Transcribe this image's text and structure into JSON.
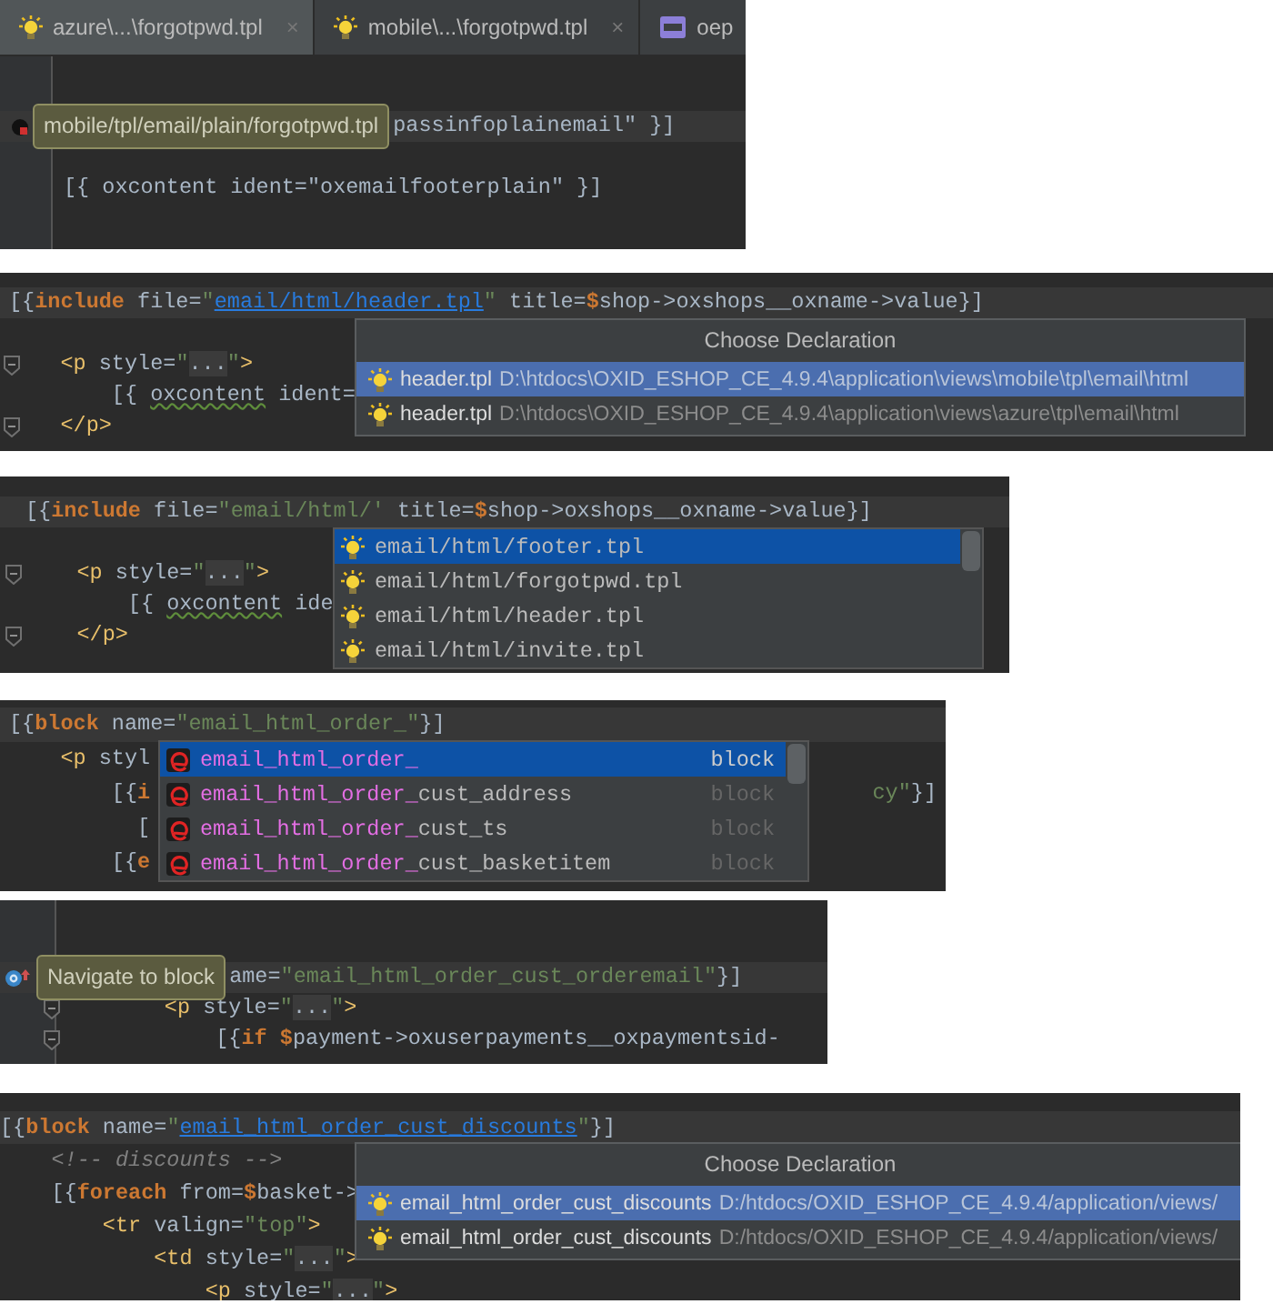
{
  "panels": [
    {
      "tabs": [
        {
          "kind": "tpl",
          "label": "azure\\...\\forgotpwd.tpl",
          "close": "×",
          "selected": true
        },
        {
          "kind": "tpl",
          "label": "mobile\\...\\forgotpwd.tpl",
          "close": "×",
          "selected": false
        },
        {
          "kind": "php",
          "label": "oep",
          "selected": false
        }
      ],
      "lines": [
        {
          "kind": "marker",
          "current": true,
          "tooltip": "mobile/tpl/email/plain/forgotpwd.tpl",
          "tokens": [
            {
              "kind": "plain",
              "text": "passinfoplainemail\" }]"
            }
          ]
        },
        {
          "kind": "code",
          "current": false
        },
        {
          "kind": "code",
          "current": false,
          "tokens": [
            {
              "kind": "plain",
              "text": "[{ oxcontent ident=\"oxemailfooterplain\" }]"
            }
          ]
        }
      ]
    },
    {
      "lines": [
        {
          "kind": "code",
          "current": true,
          "tokens": [
            {
              "kind": "plain",
              "text": "[{"
            },
            {
              "kind": "kw",
              "text": "include"
            },
            {
              "kind": "plain",
              "text": " file="
            },
            {
              "kind": "str",
              "text": "\""
            },
            {
              "kind": "link",
              "text": "email/html/header.tpl"
            },
            {
              "kind": "str",
              "text": "\""
            },
            {
              "kind": "plain",
              "text": " title="
            },
            {
              "kind": "dollar",
              "text": "$"
            },
            {
              "kind": "plain",
              "text": "shop->oxshops__oxname->value}]"
            }
          ]
        },
        {
          "kind": "code",
          "current": false
        },
        {
          "kind": "fold",
          "current": false,
          "tokens": [
            {
              "kind": "tag",
              "text": "    <p"
            },
            {
              "kind": "plain",
              "text": " style="
            },
            {
              "kind": "str",
              "text": "\""
            },
            {
              "kind": "fold",
              "text": "..."
            },
            {
              "kind": "str",
              "text": "\""
            },
            {
              "kind": "tag",
              "text": ">"
            }
          ]
        },
        {
          "kind": "code",
          "current": false,
          "tokens": [
            {
              "kind": "plain",
              "text": "        [{ "
            },
            {
              "kind": "warn",
              "text": "oxcontent"
            },
            {
              "kind": "plain",
              "text": " ident="
            }
          ]
        },
        {
          "kind": "fold",
          "current": false,
          "tokens": [
            {
              "kind": "tag",
              "text": "    </p>"
            }
          ]
        }
      ],
      "popup": {
        "kind": "declaration",
        "title": "Choose Declaration",
        "items": [
          {
            "name": "header.tpl",
            "path": "D:\\htdocs\\OXID_ESHOP_CE_4.9.4\\application\\views\\mobile\\tpl\\email\\html",
            "selected": true
          },
          {
            "name": "header.tpl",
            "path": "D:\\htdocs\\OXID_ESHOP_CE_4.9.4\\application\\views\\azure\\tpl\\email\\html",
            "selected": false
          }
        ]
      }
    },
    {
      "lines": [
        {
          "kind": "code",
          "current": true,
          "tokens": [
            {
              "kind": "plain",
              "text": "[{"
            },
            {
              "kind": "kw",
              "text": "include"
            },
            {
              "kind": "plain",
              "text": " file="
            },
            {
              "kind": "str",
              "text": "\"email/html/"
            },
            {
              "kind": "str",
              "text": "'"
            },
            {
              "kind": "plain",
              "text": " title="
            },
            {
              "kind": "dollar",
              "text": "$"
            },
            {
              "kind": "plain",
              "text": "shop->oxshops__oxname->value}]"
            }
          ]
        },
        {
          "kind": "code",
          "current": false
        },
        {
          "kind": "fold",
          "current": false,
          "tokens": [
            {
              "kind": "tag",
              "text": "    <p"
            },
            {
              "kind": "plain",
              "text": " style="
            },
            {
              "kind": "str",
              "text": "\""
            },
            {
              "kind": "fold",
              "text": "..."
            },
            {
              "kind": "str",
              "text": "\""
            },
            {
              "kind": "tag",
              "text": ">"
            }
          ]
        },
        {
          "kind": "code",
          "current": false,
          "tokens": [
            {
              "kind": "plain",
              "text": "        [{ "
            },
            {
              "kind": "warn",
              "text": "oxcontent"
            },
            {
              "kind": "plain",
              "text": " ide"
            }
          ]
        },
        {
          "kind": "fold",
          "current": false,
          "tokens": [
            {
              "kind": "tag",
              "text": "    </p>"
            }
          ]
        }
      ],
      "popup": {
        "kind": "completion",
        "items": [
          {
            "kind": "file",
            "text": "email/html/footer.tpl",
            "selected": true
          },
          {
            "kind": "file",
            "text": "email/html/forgotpwd.tpl",
            "selected": false
          },
          {
            "kind": "file",
            "text": "email/html/header.tpl",
            "selected": false
          },
          {
            "kind": "file",
            "text": "email/html/invite.tpl",
            "selected": false
          }
        ]
      }
    },
    {
      "lines": [
        {
          "kind": "code",
          "current": true,
          "tokens": [
            {
              "kind": "plain",
              "text": "[{"
            },
            {
              "kind": "kw",
              "text": "block"
            },
            {
              "kind": "plain",
              "text": " name="
            },
            {
              "kind": "str",
              "text": "\"email_html_order_\""
            },
            {
              "kind": "plain",
              "text": "}]"
            }
          ]
        },
        {
          "kind": "code",
          "current": false,
          "tokens": [
            {
              "kind": "tag",
              "text": "    <p"
            },
            {
              "kind": "plain",
              "text": " styl"
            }
          ]
        },
        {
          "kind": "code",
          "current": false,
          "tokens": [
            {
              "kind": "plain",
              "text": "        [{"
            },
            {
              "kind": "kw",
              "text": "i"
            }
          ],
          "tail": [
            {
              "kind": "str",
              "text": "cy\""
            },
            {
              "kind": "plain",
              "text": "}]"
            }
          ]
        },
        {
          "kind": "code",
          "current": false,
          "tokens": [
            {
              "kind": "plain",
              "text": "          ["
            }
          ]
        },
        {
          "kind": "code",
          "current": false,
          "tokens": [
            {
              "kind": "plain",
              "text": "        [{"
            },
            {
              "kind": "kw",
              "text": "e"
            }
          ]
        }
      ],
      "popup": {
        "kind": "completion",
        "items": [
          {
            "kind": "block",
            "match": "email_html_order_",
            "type": "block",
            "selected": true
          },
          {
            "kind": "block",
            "match": "email_html_order_",
            "rest": "cust_address",
            "type": "block",
            "selected": false
          },
          {
            "kind": "block",
            "match": "email_html_order_",
            "rest": "cust_ts",
            "type": "block",
            "selected": false
          },
          {
            "kind": "block",
            "match": "email_html_order_",
            "rest": "cust_basketitem",
            "type": "block",
            "selected": false
          }
        ]
      }
    },
    {
      "lines": [
        {
          "kind": "code",
          "current": false
        },
        {
          "kind": "code",
          "current": false
        },
        {
          "kind": "navigate",
          "current": true,
          "tooltip": "Navigate to block",
          "tokens": [
            {
              "kind": "plain",
              "text": "ame="
            },
            {
              "kind": "str",
              "text": "\"email_html_order_cust_orderemail\""
            },
            {
              "kind": "plain",
              "text": "}]"
            }
          ]
        },
        {
          "kind": "fold",
          "current": false,
          "tokens": [
            {
              "kind": "tag",
              "text": "        <p"
            },
            {
              "kind": "plain",
              "text": " style="
            },
            {
              "kind": "str",
              "text": "\""
            },
            {
              "kind": "fold",
              "text": "..."
            },
            {
              "kind": "str",
              "text": "\""
            },
            {
              "kind": "tag",
              "text": ">"
            }
          ]
        },
        {
          "kind": "fold",
          "current": false,
          "tokens": [
            {
              "kind": "plain",
              "text": "            [{"
            },
            {
              "kind": "kw",
              "text": "if"
            },
            {
              "kind": "dollar",
              "text": " $"
            },
            {
              "kind": "plain",
              "text": "payment->oxuserpayments__oxpaymentsid-"
            }
          ]
        }
      ]
    },
    {
      "lines": [
        {
          "kind": "code",
          "current": true,
          "tokens": [
            {
              "kind": "plain",
              "text": "[{"
            },
            {
              "kind": "kw",
              "text": "block"
            },
            {
              "kind": "plain",
              "text": " name="
            },
            {
              "kind": "str",
              "text": "\""
            },
            {
              "kind": "link",
              "text": "email_html_order_cust_discounts"
            },
            {
              "kind": "str",
              "text": "\""
            },
            {
              "kind": "plain",
              "text": "}]"
            }
          ]
        },
        {
          "kind": "code",
          "current": false,
          "tokens": [
            {
              "kind": "comment",
              "text": "    <!-- discounts -->"
            }
          ]
        },
        {
          "kind": "code",
          "current": false,
          "tokens": [
            {
              "kind": "plain",
              "text": "    [{"
            },
            {
              "kind": "kw",
              "text": "foreach"
            },
            {
              "kind": "plain",
              "text": " from="
            },
            {
              "kind": "dollar",
              "text": "$"
            },
            {
              "kind": "plain",
              "text": "basket->"
            }
          ]
        },
        {
          "kind": "code",
          "current": false,
          "tokens": [
            {
              "kind": "tag",
              "text": "        <tr"
            },
            {
              "kind": "plain",
              "text": " valign="
            },
            {
              "kind": "str",
              "text": "\"top\""
            },
            {
              "kind": "tag",
              "text": ">"
            }
          ]
        },
        {
          "kind": "code",
          "current": false,
          "tokens": [
            {
              "kind": "tag",
              "text": "            <td"
            },
            {
              "kind": "plain",
              "text": " style="
            },
            {
              "kind": "str",
              "text": "\""
            },
            {
              "kind": "fold",
              "text": "..."
            },
            {
              "kind": "str",
              "text": "\""
            },
            {
              "kind": "tag",
              "text": ">"
            }
          ]
        },
        {
          "kind": "code",
          "current": false,
          "tokens": [
            {
              "kind": "tag",
              "text": "                <p"
            },
            {
              "kind": "plain",
              "text": " style="
            },
            {
              "kind": "str",
              "text": "\""
            },
            {
              "kind": "fold",
              "text": "..."
            },
            {
              "kind": "str",
              "text": "\""
            },
            {
              "kind": "tag",
              "text": ">"
            }
          ]
        }
      ],
      "popup": {
        "kind": "declaration",
        "title": "Choose Declaration",
        "items": [
          {
            "name": "email_html_order_cust_discounts",
            "path": "D:/htdocs/OXID_ESHOP_CE_4.9.4/application/views/",
            "selected": true
          },
          {
            "name": "email_html_order_cust_discounts",
            "path": "D:/htdocs/OXID_ESHOP_CE_4.9.4/application/views/",
            "selected": false
          }
        ]
      }
    }
  ]
}
